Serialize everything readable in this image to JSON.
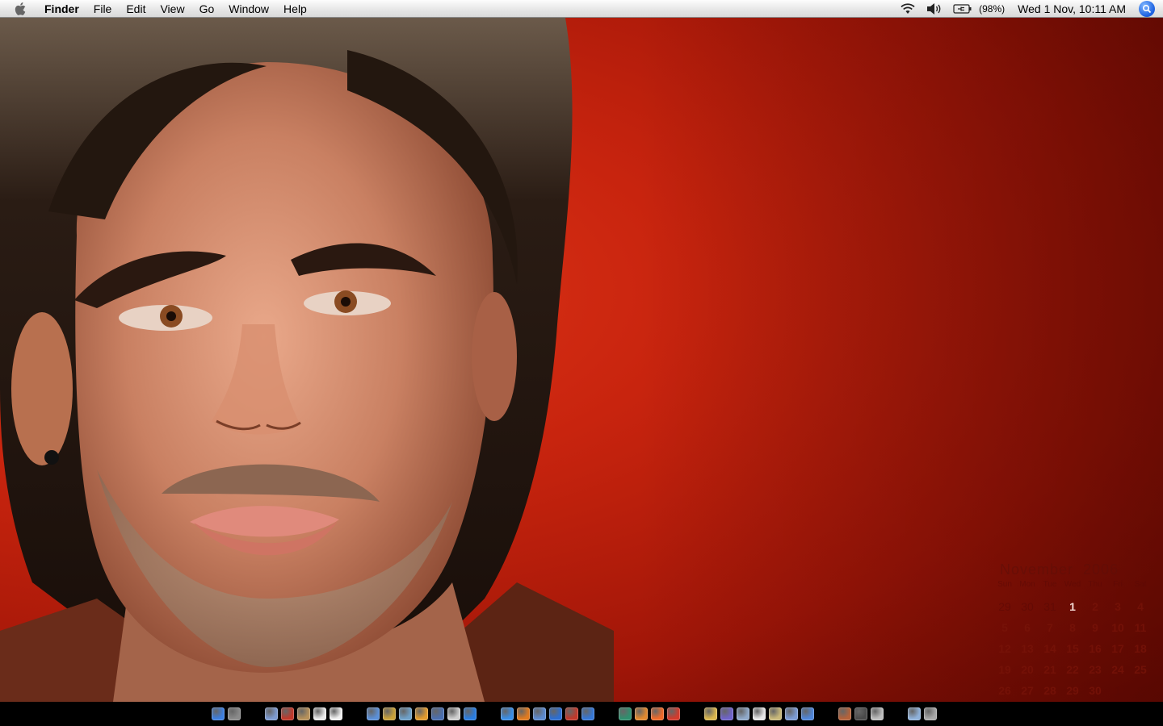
{
  "menubar": {
    "app_name": "Finder",
    "menus": [
      "File",
      "Edit",
      "View",
      "Go",
      "Window",
      "Help"
    ],
    "battery_percent": "(98%)",
    "clock": "Wed 1 Nov, 10:11 AM",
    "icons": [
      "apple-icon",
      "wifi-icon",
      "volume-icon",
      "battery-icon",
      "spotlight-icon"
    ]
  },
  "calendar": {
    "month": "November",
    "year": "2006",
    "weekdays": [
      "Sun",
      "Mon",
      "Tue",
      "Wed",
      "Thu",
      "Fri",
      "Sat"
    ],
    "weeks": [
      [
        "29",
        "30",
        "31",
        "1",
        "2",
        "3",
        "4"
      ],
      [
        "5",
        "6",
        "7",
        "8",
        "9",
        "10",
        "11"
      ],
      [
        "12",
        "13",
        "14",
        "15",
        "16",
        "17",
        "18"
      ],
      [
        "19",
        "20",
        "21",
        "22",
        "23",
        "24",
        "25"
      ],
      [
        "26",
        "27",
        "28",
        "29",
        "30",
        "1",
        "2"
      ]
    ],
    "today": "1"
  },
  "dock": {
    "groups": [
      [
        {
          "name": "finder-icon",
          "color": "#3d7fe0"
        },
        {
          "name": "system-preferences-icon",
          "color": "#8a8a8a"
        }
      ],
      [
        {
          "name": "preview-icon",
          "color": "#7d9bd1"
        },
        {
          "name": "acrobat-icon",
          "color": "#c0392b"
        },
        {
          "name": "address-book-icon",
          "color": "#b5905a"
        },
        {
          "name": "ical-icon",
          "color": "#e8e8e8"
        },
        {
          "name": "textedit-icon",
          "color": "#f0f0f0"
        }
      ],
      [
        {
          "name": "itunes-icon",
          "color": "#5b8fd6"
        },
        {
          "name": "garageband-icon",
          "color": "#c9a23a"
        },
        {
          "name": "iphoto-icon",
          "color": "#6ea0c8"
        },
        {
          "name": "imovie-icon",
          "color": "#e09a2e"
        },
        {
          "name": "idvd-icon",
          "color": "#4a6fb0"
        },
        {
          "name": "ipod-icon",
          "color": "#cfcfcf"
        },
        {
          "name": "quicktime-icon",
          "color": "#2a7de0"
        }
      ],
      [
        {
          "name": "safari-icon",
          "color": "#3a8ee6"
        },
        {
          "name": "firefox-icon",
          "color": "#e07a1f"
        },
        {
          "name": "camino-icon",
          "color": "#5c8ad0"
        },
        {
          "name": "internet-explorer-icon",
          "color": "#2c6ed1"
        },
        {
          "name": "adium-icon",
          "color": "#c0392b"
        },
        {
          "name": "mail-icon",
          "color": "#3577d6"
        }
      ],
      [
        {
          "name": "dreamweaver-icon",
          "color": "#2f8f6e"
        },
        {
          "name": "illustrator-icon",
          "color": "#e0892f"
        },
        {
          "name": "photoshop-icon",
          "color": "#ee6a2a"
        },
        {
          "name": "flash-icon",
          "color": "#d33a2c"
        }
      ],
      [
        {
          "name": "utility-icon-1",
          "color": "#d9b64d"
        },
        {
          "name": "utility-icon-2",
          "color": "#6f63c9"
        },
        {
          "name": "utility-icon-3",
          "color": "#8fa8c8"
        },
        {
          "name": "utility-icon-4",
          "color": "#e6e6e6"
        },
        {
          "name": "utility-icon-5",
          "color": "#c8b87a"
        },
        {
          "name": "utility-icon-6",
          "color": "#7b9bd4"
        },
        {
          "name": "utility-icon-7",
          "color": "#4f86d9"
        }
      ],
      [
        {
          "name": "paint-icon",
          "color": "#b4623a"
        },
        {
          "name": "terminal-icon",
          "color": "#4a4a4a"
        },
        {
          "name": "disk-utility-icon",
          "color": "#bdbdbd"
        }
      ],
      [
        {
          "name": "downloads-stack-icon",
          "color": "#8fb1da"
        },
        {
          "name": "trash-icon",
          "color": "#a8a8a8"
        }
      ]
    ]
  }
}
